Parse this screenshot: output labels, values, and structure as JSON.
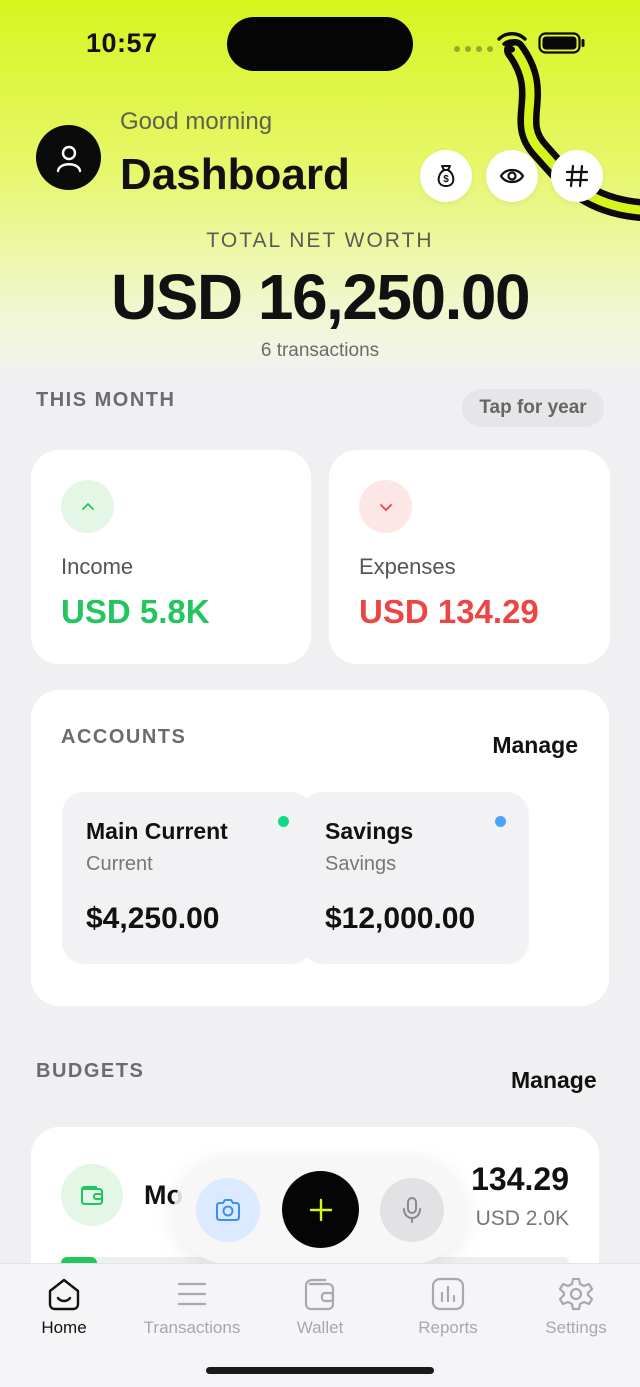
{
  "status_bar": {
    "time": "10:57"
  },
  "header": {
    "greeting": "Good morning",
    "title": "Dashboard",
    "actions": [
      "money-bag-icon",
      "eye-icon",
      "hash-icon"
    ],
    "accent": "#d6f51e"
  },
  "net_worth": {
    "label": "TOTAL NET WORTH",
    "value": "USD 16,250.00",
    "transactions": "6 transactions"
  },
  "this_month": {
    "label": "THIS MONTH",
    "toggle": "Tap for year",
    "income": {
      "label": "Income",
      "value": "USD 5.8K",
      "color": "#22c55e"
    },
    "expenses": {
      "label": "Expenses",
      "value": "USD 134.29",
      "color": "#ef4444"
    }
  },
  "accounts": {
    "label": "ACCOUNTS",
    "manage": "Manage",
    "items": [
      {
        "name": "Main Current",
        "type": "Current",
        "balance": "$4,250.00",
        "dot": "#10d98a"
      },
      {
        "name": "Savings",
        "type": "Savings",
        "balance": "$12,000.00",
        "dot": "#4aa3f5"
      }
    ]
  },
  "budgets": {
    "label": "BUDGETS",
    "manage": "Manage",
    "items": [
      {
        "name": "Mo",
        "spent": "134.29",
        "limit": "USD 2.0K",
        "progress": 0.07
      }
    ]
  },
  "tabs": [
    {
      "label": "Home",
      "icon": "home-icon",
      "active": true
    },
    {
      "label": "Transactions",
      "icon": "list-icon",
      "active": false
    },
    {
      "label": "Wallet",
      "icon": "wallet-icon",
      "active": false
    },
    {
      "label": "Reports",
      "icon": "chart-icon",
      "active": false
    },
    {
      "label": "Settings",
      "icon": "gear-icon",
      "active": false
    }
  ]
}
